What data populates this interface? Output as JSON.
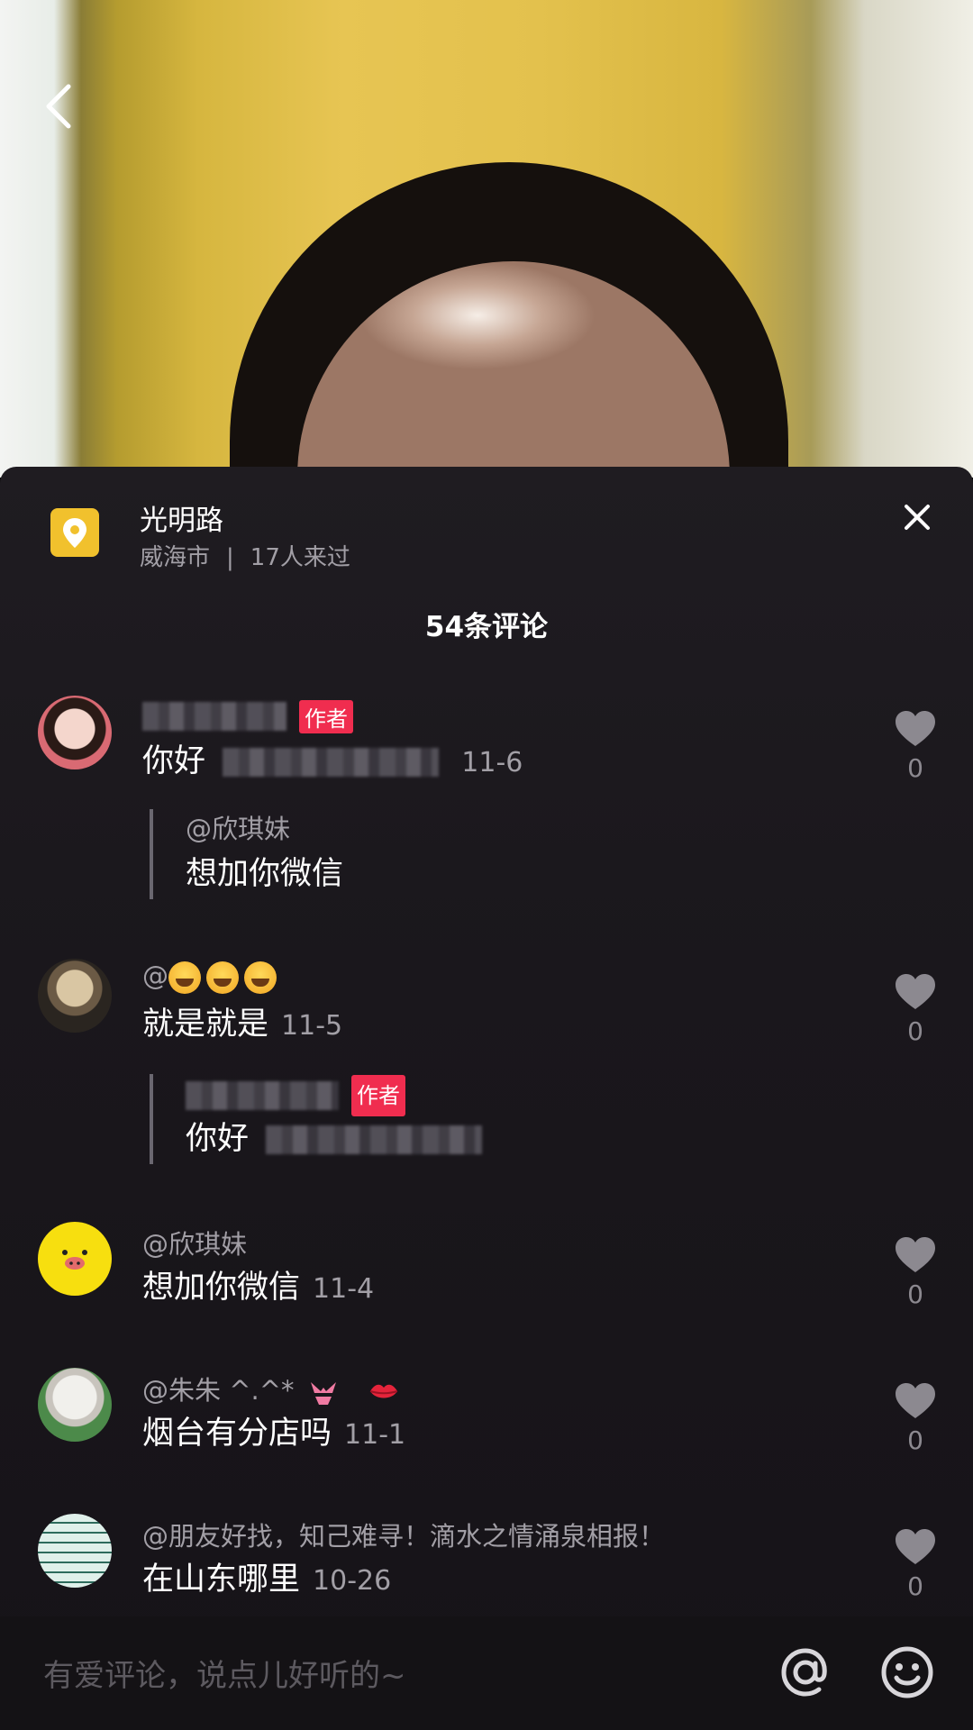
{
  "location": {
    "title": "光明路",
    "city": "威海市",
    "separator": "|",
    "visitors": "17人来过"
  },
  "comment_count": "54条评论",
  "author_tag": "作者",
  "comments": [
    {
      "text": "你好",
      "date": "11-6",
      "likes": "0",
      "reply": {
        "name": "@欣琪妹",
        "text": "想加你微信"
      }
    },
    {
      "name": "@",
      "text": "就是就是",
      "date": "11-5",
      "likes": "0",
      "reply": {
        "text": "你好"
      }
    },
    {
      "name": "@欣琪妹",
      "text": "想加你微信",
      "date": "11-4",
      "likes": "0"
    },
    {
      "name": "@朱朱 ^.^*",
      "text": "烟台有分店吗",
      "date": "11-1",
      "likes": "0"
    },
    {
      "name": "@朋友好找，知己难寻！滴水之情涌泉相报！",
      "text": "在山东哪里",
      "date": "10-26",
      "likes": "0"
    }
  ],
  "input": {
    "placeholder": "有爱评论，说点儿好听的~"
  },
  "icons": {
    "back": "back-arrow-icon",
    "close": "close-icon",
    "location": "location-pin-icon",
    "like": "heart-icon",
    "at": "at-icon",
    "emoji": "smiley-icon"
  },
  "colors": {
    "author_tag": "#f02d4f",
    "location_icon": "#f1c12d",
    "sheet_bg": "#1c191e"
  }
}
